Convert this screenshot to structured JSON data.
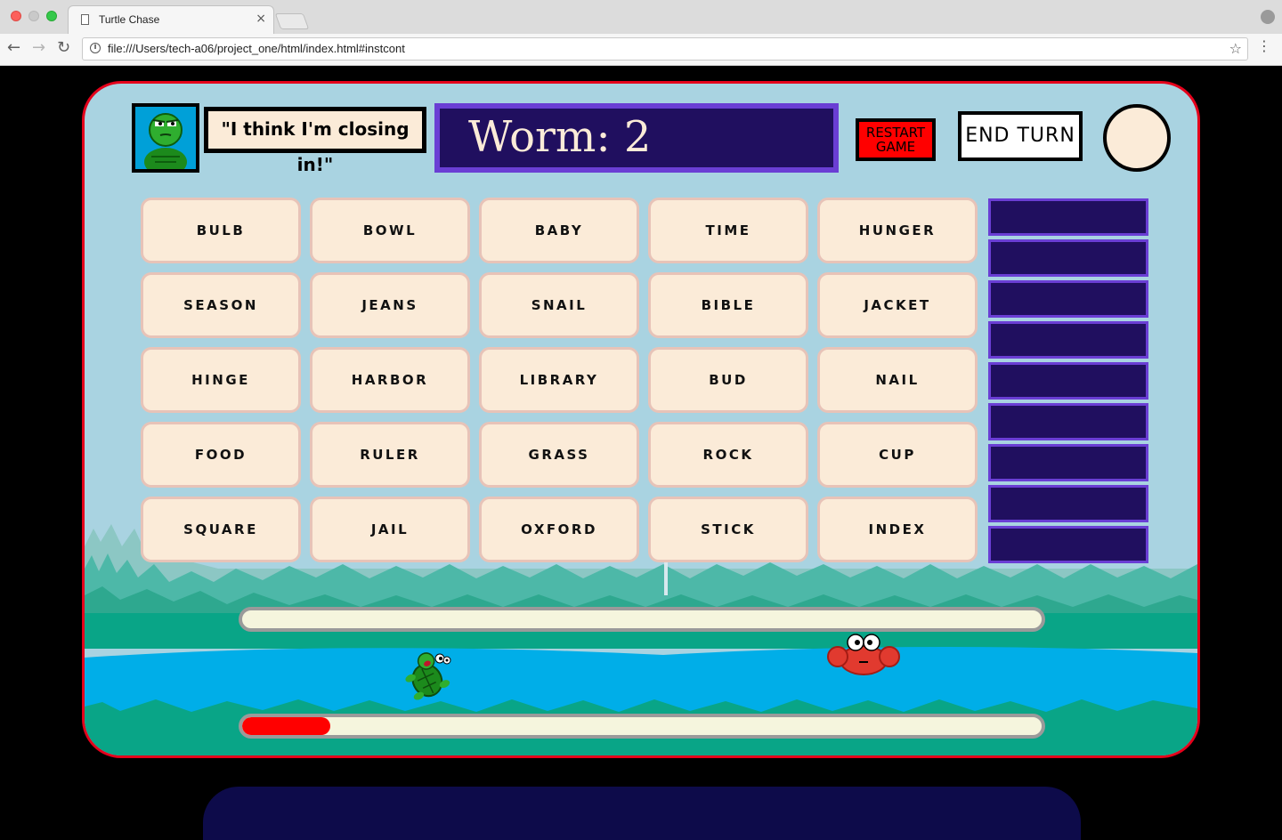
{
  "browser": {
    "tab_title": "Turtle Chase",
    "tab_close": "×",
    "url": "file:///Users/tech-a06/project_one/html/index.html#instcont",
    "icons": {
      "back": "arrow-left",
      "forward": "arrow-right",
      "reload": "reload",
      "info": "info-circle",
      "bookmark": "star",
      "menu": "vertical-dots",
      "profile": "person-circle"
    }
  },
  "game": {
    "speech": "\"I think I'm closing in!\"",
    "clue": "Worm: 2",
    "restart_label": "RESTART GAME",
    "end_turn_label": "END TURN",
    "colors": {
      "frame": "#e4001b",
      "sky": "#a9d3e1",
      "card": "#fbebd8",
      "clue_bg": "#200f5f",
      "clue_border": "#6a3ed4",
      "restart": "#ff0000",
      "progress": "#ff0000"
    },
    "cards": [
      [
        "BULB",
        "BOWL",
        "BABY",
        "TIME",
        "HUNGER"
      ],
      [
        "SEASON",
        "JEANS",
        "SNAIL",
        "BIBLE",
        "JACKET"
      ],
      [
        "HINGE",
        "HARBOR",
        "LIBRARY",
        "BUD",
        "NAIL"
      ],
      [
        "FOOD",
        "RULER",
        "GRASS",
        "ROCK",
        "CUP"
      ],
      [
        "SQUARE",
        "JAIL",
        "OXFORD",
        "STICK",
        "INDEX"
      ]
    ],
    "guess_slots": 9,
    "tracks": {
      "top_progress": 0,
      "bottom_progress": 0.11
    },
    "sprites": {
      "player": "turtle",
      "enemy": "crab"
    }
  }
}
